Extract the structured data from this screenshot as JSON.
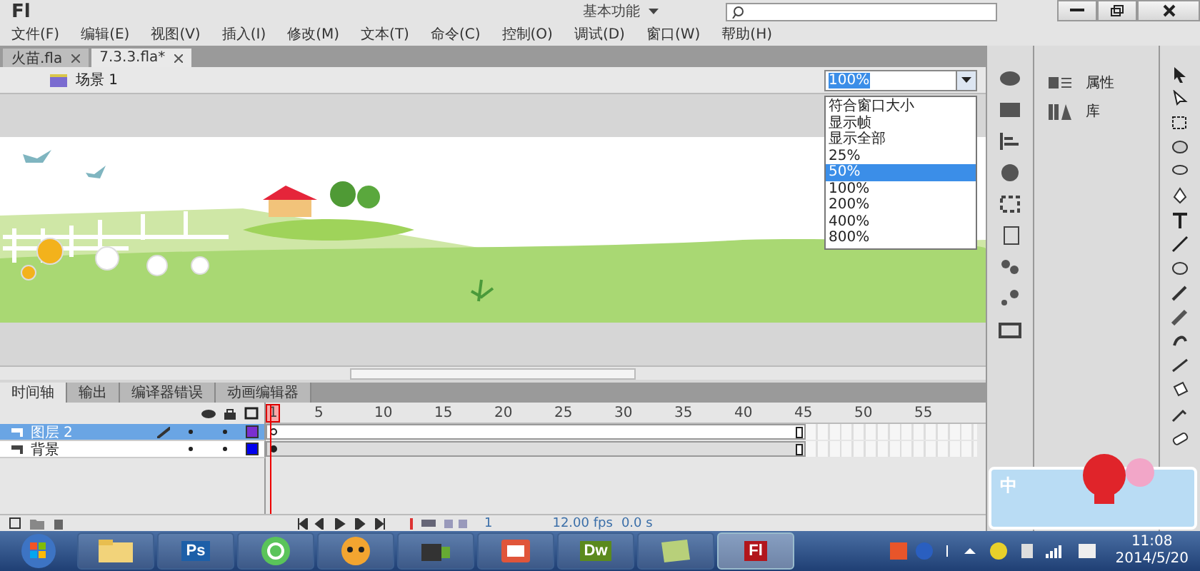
{
  "title_bar": {
    "logo": "Fl",
    "workspace": "基本功能"
  },
  "menu": [
    "文件(F)",
    "编辑(E)",
    "视图(V)",
    "插入(I)",
    "修改(M)",
    "文本(T)",
    "命令(C)",
    "控制(O)",
    "调试(D)",
    "窗口(W)",
    "帮助(H)"
  ],
  "doc_tabs": [
    {
      "label": "火苗.fla",
      "selected": false
    },
    {
      "label": "7.3.3.fla*",
      "selected": true
    }
  ],
  "edit_bar": {
    "scene": "场景 1",
    "zoom": "100%"
  },
  "zoom_menu": [
    {
      "label": "符合窗口大小",
      "selected": false
    },
    {
      "label": "显示帧",
      "selected": false
    },
    {
      "label": "显示全部",
      "selected": false
    },
    {
      "label": "25%",
      "selected": false
    },
    {
      "label": "50%",
      "selected": true
    },
    {
      "label": "100%",
      "selected": false
    },
    {
      "label": "200%",
      "selected": false
    },
    {
      "label": "400%",
      "selected": false
    },
    {
      "label": "800%",
      "selected": false
    }
  ],
  "panel_tabs": [
    {
      "label": "时间轴",
      "selected": true
    },
    {
      "label": "输出",
      "selected": false
    },
    {
      "label": "编译器错误",
      "selected": false
    },
    {
      "label": "动画编辑器",
      "selected": false
    }
  ],
  "timeline": {
    "ruler": [
      "1",
      "5",
      "10",
      "15",
      "20",
      "25",
      "30",
      "35",
      "40",
      "45",
      "50",
      "55"
    ],
    "layers": [
      {
        "name": "图层 2",
        "selected": true,
        "color": "#7b2fd0"
      },
      {
        "name": "背景",
        "selected": false,
        "color": "#0000ee"
      }
    ],
    "current_frame": "1",
    "fps": "12.00 fps",
    "time": "0.0 s"
  },
  "side_panel": [
    {
      "kind": "properties",
      "label": "属性"
    },
    {
      "kind": "library",
      "label": "库"
    }
  ],
  "ime": {
    "label": "中"
  },
  "taskbar": {
    "apps": [
      {
        "kind": "folder",
        "selected": false
      },
      {
        "kind": "ps",
        "label": "Ps",
        "selected": false
      },
      {
        "kind": "ie",
        "selected": false
      },
      {
        "kind": "qq",
        "selected": false
      },
      {
        "kind": "camera",
        "selected": false
      },
      {
        "kind": "slides",
        "selected": false
      },
      {
        "kind": "dw",
        "label": "Dw",
        "selected": false
      },
      {
        "kind": "notes",
        "selected": false
      },
      {
        "kind": "fl",
        "label": "Fl",
        "selected": true
      }
    ],
    "time": "11:08",
    "date": "2014/5/20"
  }
}
